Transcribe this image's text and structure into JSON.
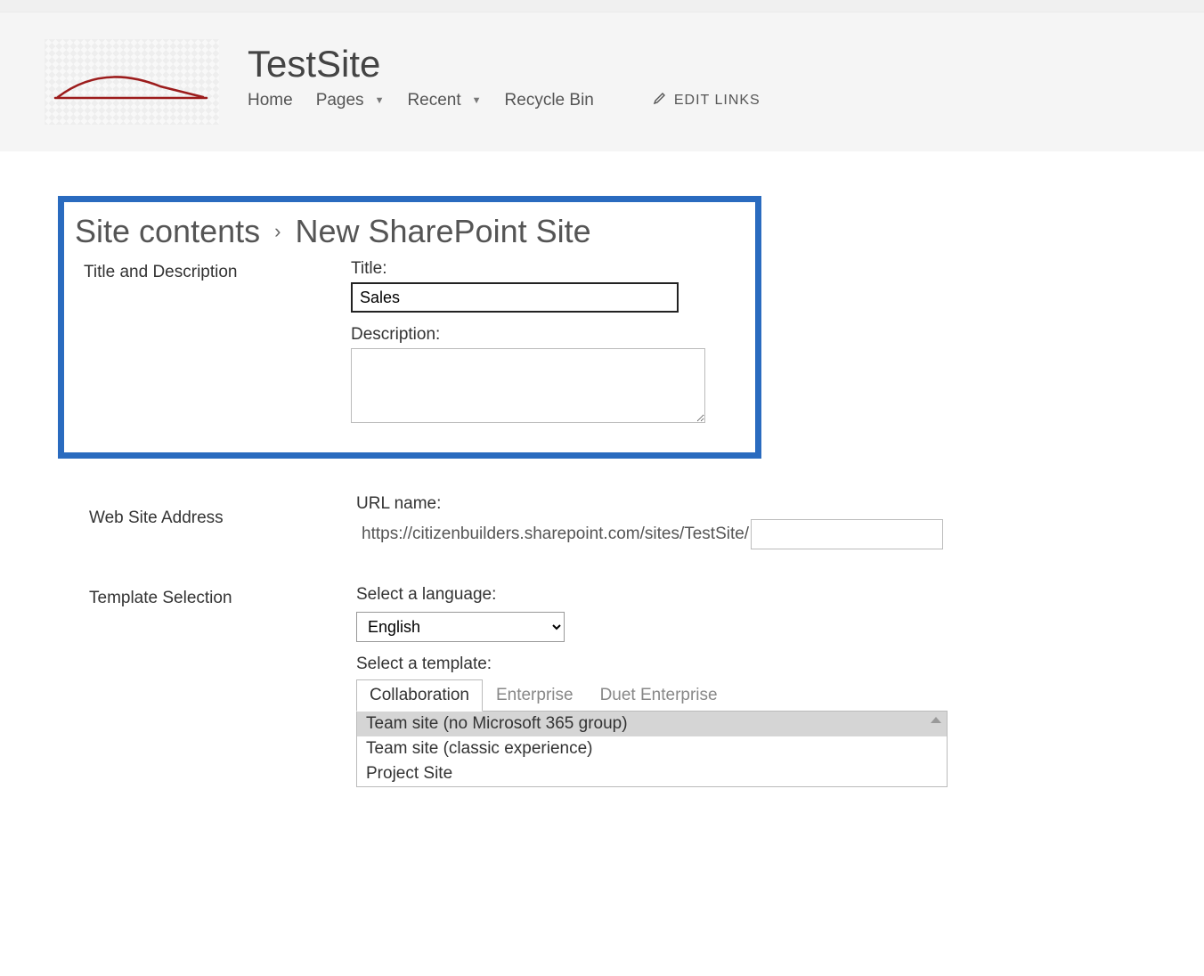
{
  "header": {
    "site_title": "TestSite",
    "nav": {
      "home": "Home",
      "pages": "Pages",
      "recent": "Recent",
      "recycle": "Recycle Bin",
      "edit_links": "EDIT LINKS"
    }
  },
  "breadcrumb": {
    "parent": "Site contents",
    "current": "New SharePoint Site"
  },
  "sections": {
    "title_desc": {
      "heading": "Title and Description",
      "title_label": "Title:",
      "title_value": "Sales",
      "desc_label": "Description:",
      "desc_value": ""
    },
    "address": {
      "heading": "Web Site Address",
      "url_label": "URL name:",
      "url_prefix": "https://citizenbuilders.sharepoint.com/sites/TestSite/",
      "url_value": ""
    },
    "template": {
      "heading": "Template Selection",
      "lang_label": "Select a language:",
      "lang_value": "English",
      "template_label": "Select a template:",
      "tabs": [
        "Collaboration",
        "Enterprise",
        "Duet Enterprise"
      ],
      "templates": [
        "Team site (no Microsoft 365 group)",
        "Team site (classic experience)",
        "Project Site"
      ],
      "selected_template_index": 0,
      "active_tab_index": 0
    }
  }
}
